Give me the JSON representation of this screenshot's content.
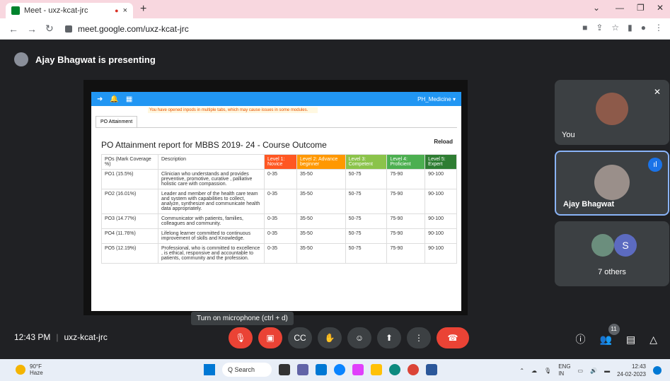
{
  "browser": {
    "tab_title": "Meet - uxz-kcat-jrc",
    "tab_close": "×",
    "rec_icon": "●",
    "new_tab": "+",
    "url": "meet.google.com/uxz-kcat-jrc",
    "window_controls": [
      "⌄",
      "—",
      "❐",
      "✕"
    ]
  },
  "presenter": {
    "text": "Ajay Bhagwat is presenting"
  },
  "shared": {
    "user": "PH_Medicine ▾",
    "warning": "You have opened inpods in multiple tabs, which may cause issues in some modules.",
    "tab": "PO Attainment",
    "title": "PO Attainment report for MBBS 2019- 24 - Course Outcome",
    "reload": "Reload",
    "headers": [
      "POs (Mark Coverage %)",
      "Description",
      "Level 1: Novice",
      "Level 2: Advance beginner",
      "Level 3: Competent",
      "Level 4: Proficient",
      "Level 5: Expert"
    ],
    "rows": [
      {
        "po": "PO1 (15.5%)",
        "desc": "Clinician who understands and provides preventive, promotive, curative , palliative holistic care with compassion.",
        "l1": "0-35",
        "l2": "35-50",
        "l3": "50-75",
        "l4": "75-90",
        "l5": "90-100"
      },
      {
        "po": "PO2 (16.01%)",
        "desc": "Leader and member of the health care team and system with capabilities to collect, analyze, synthesize and communicate health data appropriately.",
        "l1": "0-35",
        "l2": "35-50",
        "l3": "50-75",
        "l4": "75-90",
        "l5": "90-100"
      },
      {
        "po": "PO3 (14.77%)",
        "desc": "Communicator with patients, families, colleagues and community.",
        "l1": "0-35",
        "l2": "35-50",
        "l3": "50-75",
        "l4": "75-90",
        "l5": "90-100"
      },
      {
        "po": "PO4 (11.76%)",
        "desc": "Lifelong learner committed to continuous improvement of skills and Knowledge.",
        "l1": "0-35",
        "l2": "35-50",
        "l3": "50-75",
        "l4": "75-90",
        "l5": "90-100"
      },
      {
        "po": "PO5 (12.19%)",
        "desc": "Professional, who is committed to excellence , is ethical, responsive and accountable to patients, community and the profession.",
        "l1": "0-35",
        "l2": "35-50",
        "l3": "50-75",
        "l4": "75-90",
        "l5": "90-100"
      }
    ]
  },
  "tiles": {
    "you": "You",
    "ajay": "Ajay Bhagwat",
    "others_initial": "S",
    "others": "7 others"
  },
  "tooltip": "Turn on microphone (ctrl + d)",
  "meeting": {
    "time": "12:43 PM",
    "separator": "|",
    "code": "uxz-kcat-jrc",
    "participant_count": "11"
  },
  "taskbar": {
    "temp": "90°F",
    "weather": "Haze",
    "search": "Q Search",
    "lang": "ENG",
    "region": "IN",
    "time": "12:43",
    "date": "24-02-2023"
  }
}
